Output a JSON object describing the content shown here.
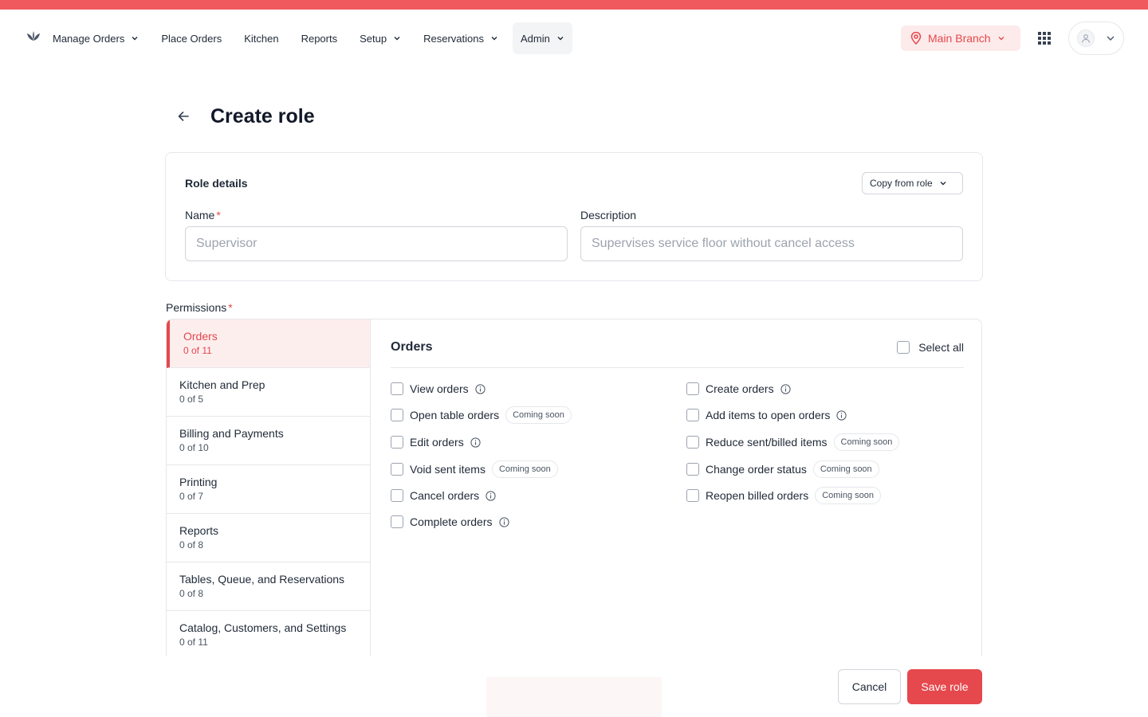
{
  "nav": {
    "logo_icon": "leaf-logo-icon",
    "items": [
      {
        "label": "Manage Orders",
        "dropdown": true
      },
      {
        "label": "Place Orders",
        "dropdown": false
      },
      {
        "label": "Kitchen",
        "dropdown": false
      },
      {
        "label": "Reports",
        "dropdown": false
      },
      {
        "label": "Setup",
        "dropdown": true
      },
      {
        "label": "Reservations",
        "dropdown": true
      },
      {
        "label": "Admin",
        "dropdown": true,
        "active": true
      }
    ],
    "branch": "Main Branch",
    "apps_icon": "grid-icon",
    "user_icon": "user-icon"
  },
  "page": {
    "title": "Create role",
    "back_icon": "arrow-left-icon"
  },
  "role_details": {
    "title": "Role details",
    "copy_button": "Copy from role",
    "name_label": "Name",
    "name_placeholder": "Supervisor",
    "description_label": "Description",
    "description_placeholder": "Supervises service floor without cancel access",
    "required_mark": "*"
  },
  "permissions": {
    "label": "Permissions",
    "categories": [
      {
        "name": "Orders",
        "count": "0 of 11",
        "active": true
      },
      {
        "name": "Kitchen and Prep",
        "count": "0 of 5"
      },
      {
        "name": "Billing and Payments",
        "count": "0 of 10"
      },
      {
        "name": "Printing",
        "count": "0 of 7"
      },
      {
        "name": "Reports",
        "count": "0 of 8"
      },
      {
        "name": "Tables, Queue, and Reservations",
        "count": "0 of 8"
      },
      {
        "name": "Catalog, Customers, and Settings",
        "count": "0 of 11"
      }
    ],
    "section_title": "Orders",
    "select_all": "Select all",
    "coming_soon": "Coming soon",
    "left_column": [
      {
        "label": "View orders",
        "info": true
      },
      {
        "label": "Open table orders",
        "badge": true
      },
      {
        "label": "Edit orders",
        "info": true
      },
      {
        "label": "Void sent items",
        "badge": true
      },
      {
        "label": "Cancel orders",
        "info": true
      },
      {
        "label": "Complete orders",
        "info": true
      }
    ],
    "right_column": [
      {
        "label": "Create orders",
        "info": true
      },
      {
        "label": "Add items to open orders",
        "info": true
      },
      {
        "label": "Reduce sent/billed items",
        "badge": true
      },
      {
        "label": "Change order status",
        "badge": true
      },
      {
        "label": "Reopen billed orders",
        "badge": true
      }
    ]
  },
  "footer": {
    "cancel": "Cancel",
    "save": "Save role"
  },
  "colors": {
    "accent": "#e5484d",
    "topbar": "#f05a5f",
    "accent_bg": "#fdeeee"
  }
}
